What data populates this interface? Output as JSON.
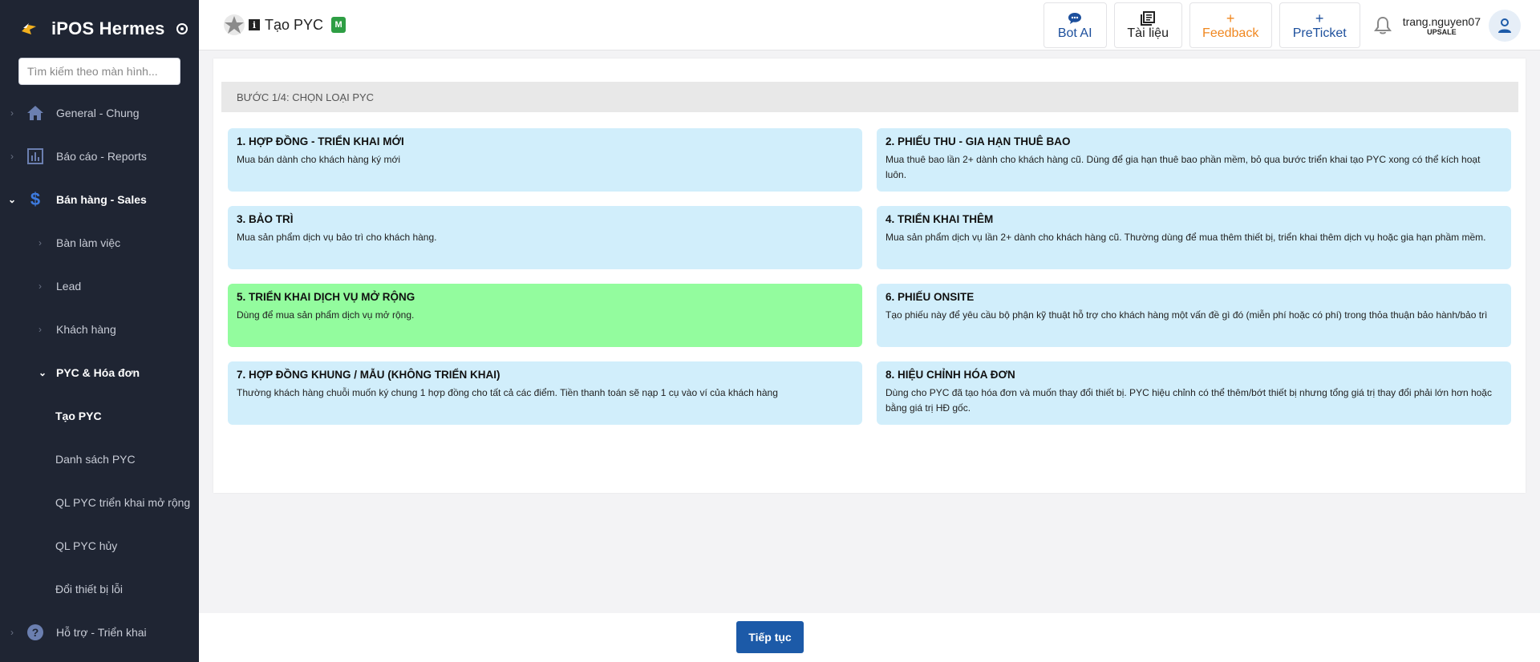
{
  "app": {
    "name": "iPOS Hermes"
  },
  "search": {
    "placeholder": "Tìm kiếm theo màn hình..."
  },
  "sidebar": {
    "items": [
      {
        "label": "General - Chung",
        "icon": "home-icon"
      },
      {
        "label": "Báo cáo - Reports",
        "icon": "bar-chart-icon"
      },
      {
        "label": "Bán hàng - Sales",
        "icon": "dollar-icon"
      },
      {
        "label": "Hỗ trợ - Triển khai",
        "icon": "help-circle-icon"
      }
    ],
    "sales_sub": [
      {
        "label": "Bàn làm việc"
      },
      {
        "label": "Lead"
      },
      {
        "label": "Khách hàng"
      },
      {
        "label": "PYC & Hóa đơn"
      }
    ],
    "pyc_sub": [
      {
        "label": "Tạo PYC"
      },
      {
        "label": "Danh sách PYC"
      },
      {
        "label": "QL PYC triển khai mở rộng"
      },
      {
        "label": "QL PYC hủy"
      },
      {
        "label": "Đổi thiết bị lỗi"
      }
    ]
  },
  "header": {
    "title": "Tạo PYC",
    "badge": "M",
    "buttons": {
      "bot_ai": "Bot AI",
      "docs": "Tài liệu",
      "feedback": "Feedback",
      "preticket": "PreTicket"
    },
    "user": {
      "name": "trang.nguyen07",
      "role": "UPSALE"
    }
  },
  "main": {
    "step_label": "BƯỚC 1/4: CHỌN LOẠI PYC",
    "options": [
      {
        "title": "1. HỢP ĐỒNG - TRIỂN KHAI MỚI",
        "desc": "Mua bán dành cho khách hàng ký mới"
      },
      {
        "title": "2. PHIẾU THU - GIA HẠN THUÊ BAO",
        "desc": "Mua thuê bao lần 2+ dành cho khách hàng cũ. Dùng để gia hạn thuê bao phần mềm, bỏ qua bước triển khai tạo PYC xong có thể kích hoạt luôn."
      },
      {
        "title": "3. BẢO TRÌ",
        "desc": "Mua sản phẩm dịch vụ bảo trì cho khách hàng."
      },
      {
        "title": "4. TRIỂN KHAI THÊM",
        "desc": "Mua sản phẩm dịch vụ lần 2+ dành cho khách hàng cũ. Thường dùng để mua thêm thiết bị, triển khai thêm dịch vụ hoặc gia hạn phầm mềm."
      },
      {
        "title": "5. TRIỂN KHAI DỊCH VỤ MỞ RỘNG",
        "desc": "Dùng để mua sản phẩm dịch vụ mở rộng."
      },
      {
        "title": "6. PHIẾU ONSITE",
        "desc": "Tạo phiếu này để yêu cầu bộ phận kỹ thuật hỗ trợ cho khách hàng một vấn đề gì đó (miễn phí hoặc có phí) trong thỏa thuận bảo hành/bảo trì"
      },
      {
        "title": "7. HỢP ĐỒNG KHUNG / MẪU (KHÔNG TRIỂN KHAI)",
        "desc": "Thường khách hàng chuỗi muốn ký chung 1 hợp đồng cho tất cả các điểm. Tiền thanh toán sẽ nạp 1 cụ vào ví của khách hàng"
      },
      {
        "title": "8. HIỆU CHỈNH HÓA ĐƠN",
        "desc": "Dùng cho PYC đã tạo hóa đơn và muốn thay đổi thiết bị. PYC hiệu chỉnh có thể thêm/bớt thiết bị nhưng tổng giá trị thay đổi phải lớn hơn hoặc bằng giá trị HĐ gốc."
      }
    ]
  },
  "footer": {
    "next_label": "Tiếp tục"
  },
  "colors": {
    "sidebar_bg": "#1f2533",
    "option_bg": "#d1eefb",
    "option_selected_bg": "#93fc9e",
    "primary": "#1c5aa8",
    "feedback": "#f0871f"
  }
}
